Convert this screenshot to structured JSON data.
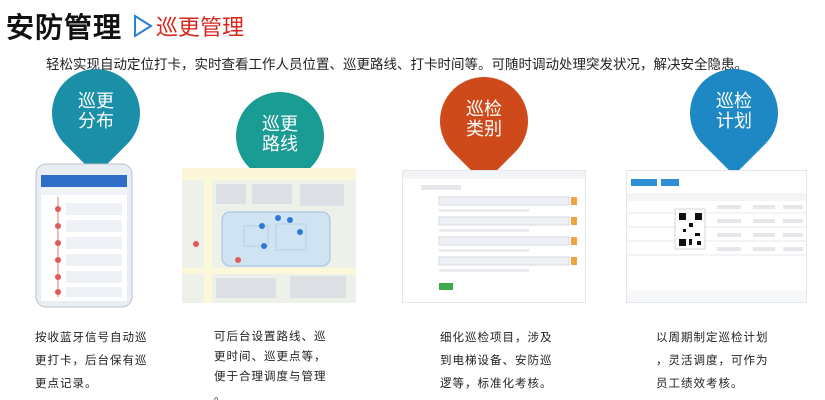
{
  "header": {
    "title": "安防管理",
    "section": "巡更管理",
    "arrow_icon": "triangle-outline-right-icon",
    "subtitle": "轻松实现自动定位打卡，实时查看工作人员位置、巡更路线、打卡时间等。可随时调动处理突发状况，解决安全隐患。"
  },
  "colors": {
    "teal": "#1c8fa8",
    "green_teal": "#1a9c95",
    "orange": "#cf4a1a",
    "blue": "#1e88c4",
    "red": "#d9261c"
  },
  "features": [
    {
      "label_line1": "巡更",
      "label_line2": "分布",
      "description": [
        "按收蓝牙信号自动巡",
        "更打卡，后台保有巡",
        "更点记录。"
      ]
    },
    {
      "label_line1": "巡更",
      "label_line2": "路线",
      "description": [
        "可后台设置路线、巡",
        "更时间、巡更点等，",
        "便于合理调度与管理",
        "。"
      ]
    },
    {
      "label_line1": "巡检",
      "label_line2": "类别",
      "description": [
        "细化巡检项目，涉及",
        "到电梯设备、安防巡",
        "逻等，标准化考核。"
      ]
    },
    {
      "label_line1": "巡检",
      "label_line2": "计划",
      "description": [
        "以周期制定巡检计划",
        "，灵活调度，可作为",
        "员工绩效考核。"
      ]
    }
  ]
}
